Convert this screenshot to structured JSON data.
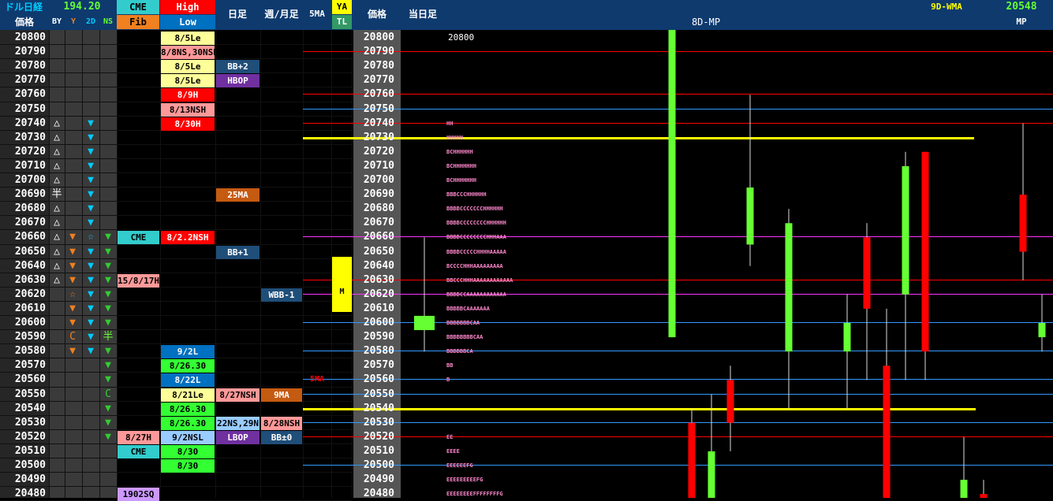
{
  "header": {
    "title": "ドル日経",
    "usdjpy": "194.20",
    "price_label": "価格",
    "col_by": "BY",
    "col_y": "Y",
    "col_2d": "2D",
    "col_ns": "NS",
    "cme": "CME",
    "fib": "Fib",
    "high": "High",
    "low": "Low",
    "daily": "日足",
    "weekly_monthly": "週/月足",
    "ma5": "5MA",
    "ya": "YA",
    "tl": "TL",
    "price2": "価格",
    "today_bar": "当日足",
    "mp8d": "8D-MP",
    "wma9d": "9D-WMA",
    "mp_value": "20548",
    "mp": "MP"
  },
  "prices": [
    20800,
    20790,
    20780,
    20770,
    20760,
    20750,
    20740,
    20730,
    20720,
    20710,
    20700,
    20690,
    20680,
    20670,
    20660,
    20650,
    20640,
    20630,
    20620,
    20610,
    20600,
    20590,
    20580,
    20570,
    20560,
    20550,
    20540,
    20530,
    20520,
    20510,
    20500,
    20490,
    20480
  ],
  "sym_by": {
    "20740": "△",
    "20730": "△",
    "20720": "△",
    "20710": "△",
    "20700": "△",
    "20690": "半",
    "20680": "△",
    "20670": "△",
    "20660": "△",
    "20650": "△",
    "20640": "△",
    "20630": "△"
  },
  "sym_y": {
    "20660": "▼",
    "20650": "▼",
    "20640": "▼",
    "20630": "▼",
    "20620": "☆",
    "20610": "▼",
    "20600": "▼",
    "20590": "C",
    "20580": "▼"
  },
  "sym_2d": {
    "20740": "▼",
    "20730": "▼",
    "20720": "▼",
    "20710": "▼",
    "20700": "▼",
    "20690": "▼",
    "20680": "▼",
    "20670": "▼",
    "20660": "☆",
    "20650": "▼",
    "20640": "▼",
    "20630": "▼",
    "20620": "▼",
    "20610": "▼",
    "20600": "▼",
    "20590": "▼",
    "20580": "▼"
  },
  "sym_ns": {
    "20660": "▼",
    "20650": "▼",
    "20640": "▼",
    "20630": "▼",
    "20620": "▼",
    "20610": "▼",
    "20600": "▼",
    "20590": "半",
    "20580": "▼",
    "20570": "▼",
    "20560": "▼",
    "20550": "C",
    "20540": "▼",
    "20530": "▼",
    "20520": "▼"
  },
  "colors": {
    "header_bg": "#0e3a6e",
    "high_red": "#ff0000",
    "low_blue": "#0070c0",
    "cme_teal": "#33cccc",
    "fib_orange": "#f08020",
    "ya_yellow": "#ffff00",
    "tl_green": "#339966",
    "bull_green": "#66ff33",
    "bear_red": "#ff0000"
  },
  "cme_col": [
    {
      "price": 20660,
      "text": "CME",
      "bg": "#33cccc",
      "fg": "#000"
    },
    {
      "price": 20630,
      "text": "15/8/17H",
      "bg": "#ff9999",
      "fg": "#000"
    },
    {
      "price": 20520,
      "text": "8/27H",
      "bg": "#ff9999",
      "fg": "#000"
    },
    {
      "price": 20510,
      "text": "CME",
      "bg": "#33cccc",
      "fg": "#000"
    },
    {
      "price": 20480,
      "text": "1902SQ",
      "bg": "#cc99ff",
      "fg": "#000"
    }
  ],
  "hl_col": [
    {
      "price": 20800,
      "text": "8/5Le",
      "bg": "#ffff99",
      "fg": "#000"
    },
    {
      "price": 20790,
      "text": "8/8NS,30NSH",
      "bg": "#ff9999",
      "fg": "#000"
    },
    {
      "price": 20780,
      "text": "8/5Le",
      "bg": "#ffff99",
      "fg": "#000"
    },
    {
      "price": 20770,
      "text": "8/5Le",
      "bg": "#ffff99",
      "fg": "#000"
    },
    {
      "price": 20760,
      "text": "8/9H",
      "bg": "#ff0000",
      "fg": "#fff"
    },
    {
      "price": 20750,
      "text": "8/13NSH",
      "bg": "#ff9999",
      "fg": "#000"
    },
    {
      "price": 20740,
      "text": "8/30H",
      "bg": "#ff0000",
      "fg": "#fff"
    },
    {
      "price": 20660,
      "text": "8/2.2NSH",
      "bg": "#ff0000",
      "fg": "#fff"
    },
    {
      "price": 20580,
      "text": "9/2L",
      "bg": "#0070c0",
      "fg": "#fff"
    },
    {
      "price": 20570,
      "text": "8/26.30",
      "bg": "#33ff33",
      "fg": "#000"
    },
    {
      "price": 20560,
      "text": "8/22L",
      "bg": "#0070c0",
      "fg": "#fff"
    },
    {
      "price": 20550,
      "text": "8/21Le",
      "bg": "#ffff99",
      "fg": "#000"
    },
    {
      "price": 20540,
      "text": "8/26.30",
      "bg": "#33ff33",
      "fg": "#000"
    },
    {
      "price": 20530,
      "text": "8/26.30",
      "bg": "#33ff33",
      "fg": "#000"
    },
    {
      "price": 20520,
      "text": "9/2NSL",
      "bg": "#99ccff",
      "fg": "#000"
    },
    {
      "price": 20510,
      "text": "8/30",
      "bg": "#33ff33",
      "fg": "#000"
    },
    {
      "price": 20500,
      "text": "8/30",
      "bg": "#33ff33",
      "fg": "#000"
    }
  ],
  "daily_col": [
    {
      "price": 20780,
      "text": "BB+2",
      "bg": "#1f4e79",
      "fg": "#fff"
    },
    {
      "price": 20770,
      "text": "HBOP",
      "bg": "#7030a0",
      "fg": "#fff"
    },
    {
      "price": 20690,
      "text": "25MA",
      "bg": "#c55a11",
      "fg": "#fff"
    },
    {
      "price": 20650,
      "text": "BB+1",
      "bg": "#1f4e79",
      "fg": "#fff"
    },
    {
      "price": 20550,
      "text": "8/27NSH",
      "bg": "#ff9999",
      "fg": "#000"
    },
    {
      "price": 20530,
      "text": "22NS,29N",
      "bg": "#99ccff",
      "fg": "#000"
    },
    {
      "price": 20520,
      "text": "LBOP",
      "bg": "#7030a0",
      "fg": "#fff"
    }
  ],
  "weekly_col": [
    {
      "price": 20620,
      "text": "WBB-1",
      "bg": "#1f4e79",
      "fg": "#fff"
    },
    {
      "price": 20550,
      "text": "9MA",
      "bg": "#c55a11",
      "fg": "#fff"
    },
    {
      "price": 20530,
      "text": "8/28NSH",
      "bg": "#ff9999",
      "fg": "#000"
    },
    {
      "price": 20520,
      "text": "BB±0",
      "bg": "#1f4e79",
      "fg": "#fff"
    }
  ],
  "ma5_label": {
    "price": 20560,
    "text": "5MA"
  },
  "ya_marker": {
    "text": "M"
  },
  "today_top_label": "20800",
  "tpo_rows": [
    {
      "price": 20740,
      "text": "HH"
    },
    {
      "price": 20730,
      "text": "HHHHH"
    },
    {
      "price": 20720,
      "text": "BCHHHHHH"
    },
    {
      "price": 20710,
      "text": "BCHHHHHHH"
    },
    {
      "price": 20700,
      "text": "BCHHHHHHH"
    },
    {
      "price": 20690,
      "text": "BBBCCCHHHHHH"
    },
    {
      "price": 20680,
      "text": "BBBBCCCCCCCHHHHHH"
    },
    {
      "price": 20670,
      "text": "BBBBCCCCCCCCHHHHHH"
    },
    {
      "price": 20660,
      "text": "BBBBCCCCCCCCHHHAAA"
    },
    {
      "price": 20650,
      "text": "BBBBCCCCCHHHHAAAAA"
    },
    {
      "price": 20640,
      "text": "BCCCCHHHAAAAAAAAA"
    },
    {
      "price": 20630,
      "text": "BBCCCHHHAAAAAAAAAAAA"
    },
    {
      "price": 20620,
      "text": "BBBBCCAAAAAAAAAAAA"
    },
    {
      "price": 20610,
      "text": "BBBBBCAAAAAAA"
    },
    {
      "price": 20600,
      "text": "BBBBBBBCAA"
    },
    {
      "price": 20590,
      "text": "BBBBBBBBCAA"
    },
    {
      "price": 20580,
      "text": "BBBBBBCA"
    },
    {
      "price": 20570,
      "text": "BB"
    },
    {
      "price": 20560,
      "text": "B"
    },
    {
      "price": 20520,
      "text": "EE"
    },
    {
      "price": 20510,
      "text": "EEEE"
    },
    {
      "price": 20500,
      "text": "EEEEEEFG"
    },
    {
      "price": 20490,
      "text": "EEEEEEEEEFG"
    },
    {
      "price": 20480,
      "text": "EEEEEEEEFFFFFFFFG"
    }
  ],
  "levels": [
    {
      "price": 20790,
      "color": "#ff0000"
    },
    {
      "price": 20760,
      "color": "#ff0000"
    },
    {
      "price": 20750,
      "color": "#3399ff"
    },
    {
      "price": 20740,
      "color": "#ff0000"
    },
    {
      "price": 20660,
      "color": "#ff33ff"
    },
    {
      "price": 20630,
      "color": "#ff0000"
    },
    {
      "price": 20620,
      "color": "#ff33ff"
    },
    {
      "price": 20600,
      "color": "#3399ff"
    },
    {
      "price": 20580,
      "color": "#3399ff"
    },
    {
      "price": 20560,
      "color": "#3399ff"
    },
    {
      "price": 20550,
      "color": "#3399ff"
    },
    {
      "price": 20530,
      "color": "#3399ff"
    },
    {
      "price": 20520,
      "color": "#ff0000"
    },
    {
      "price": 20500,
      "color": "#3399ff"
    }
  ],
  "yellow_levels": [
    {
      "price": 20730,
      "end": 1235
    },
    {
      "price": 20540,
      "end": 1237
    }
  ],
  "chart_data": {
    "type": "candlestick",
    "title": "8D-MP",
    "ylim": [
      20480,
      20800
    ],
    "candles": [
      {
        "o": 20595,
        "c": 20605,
        "h": 20660,
        "l": 20580,
        "color": "green"
      },
      {
        "o": 20590,
        "c": 20810,
        "h": 20810,
        "l": 20590,
        "color": "green"
      },
      {
        "o": 20380,
        "c": 20530,
        "h": 20540,
        "l": 20330,
        "color": "red"
      },
      {
        "o": 20470,
        "c": 20510,
        "h": 20550,
        "l": 20330,
        "color": "green"
      },
      {
        "o": 20560,
        "c": 20530,
        "h": 20570,
        "l": 20510,
        "color": "red"
      },
      {
        "o": 20655,
        "c": 20695,
        "h": 20760,
        "l": 20640,
        "color": "green"
      },
      {
        "o": 20580,
        "c": 20670,
        "h": 20680,
        "l": 20540,
        "color": "green"
      },
      {
        "o": 20580,
        "c": 20600,
        "h": 20620,
        "l": 20540,
        "color": "green"
      },
      {
        "o": 20660,
        "c": 20610,
        "h": 20670,
        "l": 20560,
        "color": "red"
      },
      {
        "o": 20570,
        "c": 20400,
        "h": 20610,
        "l": 20380,
        "color": "red"
      },
      {
        "o": 20620,
        "c": 20710,
        "h": 20720,
        "l": 20560,
        "color": "green"
      },
      {
        "o": 20720,
        "c": 20580,
        "h": 20720,
        "l": 20560,
        "color": "red"
      },
      {
        "o": 20460,
        "c": 20490,
        "h": 20520,
        "l": 20450,
        "color": "green"
      },
      {
        "o": 20480,
        "c": 20460,
        "h": 20490,
        "l": 20440,
        "color": "red"
      },
      {
        "o": 20690,
        "c": 20650,
        "h": 20740,
        "l": 20630,
        "color": "red"
      },
      {
        "o": 20590,
        "c": 20600,
        "h": 20620,
        "l": 20580,
        "color": "green"
      }
    ]
  }
}
